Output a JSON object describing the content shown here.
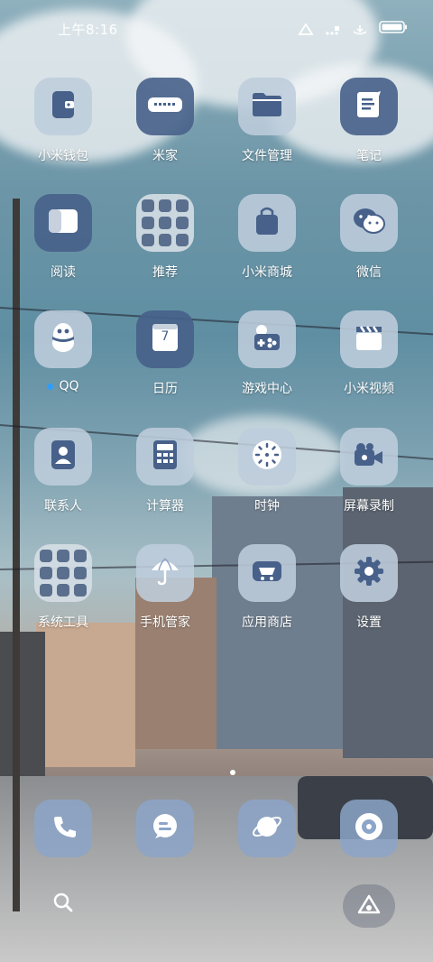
{
  "status_bar": {
    "time": "上午8:16"
  },
  "apps": [
    {
      "label": "小米钱包",
      "icon": "wallet-icon"
    },
    {
      "label": "米家",
      "icon": "mihome-icon"
    },
    {
      "label": "文件管理",
      "icon": "folder-icon"
    },
    {
      "label": "笔记",
      "icon": "notes-icon"
    },
    {
      "label": "阅读",
      "icon": "book-icon"
    },
    {
      "label": "推荐",
      "icon": "folder-group-icon"
    },
    {
      "label": "小米商城",
      "icon": "shopping-bag-icon"
    },
    {
      "label": "微信",
      "icon": "wechat-icon"
    },
    {
      "label": "QQ",
      "icon": "qq-penguin-icon"
    },
    {
      "label": "日历",
      "icon": "calendar-icon",
      "day": "7"
    },
    {
      "label": "游戏中心",
      "icon": "gamepad-icon"
    },
    {
      "label": "小米视频",
      "icon": "clapperboard-icon"
    },
    {
      "label": "联系人",
      "icon": "contacts-icon"
    },
    {
      "label": "计算器",
      "icon": "calculator-icon"
    },
    {
      "label": "时钟",
      "icon": "clock-icon"
    },
    {
      "label": "屏幕录制",
      "icon": "video-camera-icon"
    },
    {
      "label": "系统工具",
      "icon": "folder-group-icon"
    },
    {
      "label": "手机管家",
      "icon": "umbrella-icon"
    },
    {
      "label": "应用商店",
      "icon": "cart-icon"
    },
    {
      "label": "设置",
      "icon": "gear-icon"
    }
  ],
  "dock": [
    {
      "icon": "phone-icon"
    },
    {
      "icon": "message-icon"
    },
    {
      "icon": "planet-browser-icon"
    },
    {
      "icon": "music-disc-icon"
    }
  ],
  "colors": {
    "tile_light": "#d4dce4",
    "tile_dark": "#47618a",
    "accent_dot": "#2f9dff"
  }
}
